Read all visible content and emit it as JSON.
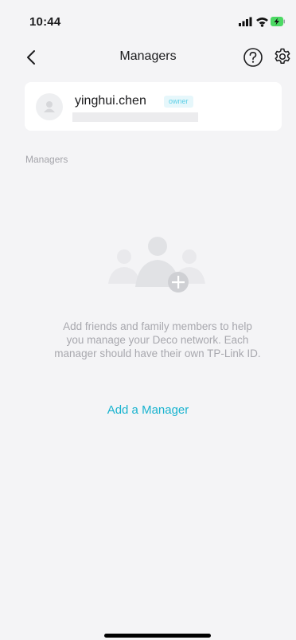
{
  "status_bar": {
    "time": "10:44"
  },
  "nav": {
    "title": "Managers"
  },
  "owner": {
    "name": "yinghui.chen",
    "badge": "owner"
  },
  "section": {
    "label": "Managers"
  },
  "empty_state": {
    "message_lines": [
      "Add friends and family members to help",
      "you manage your Deco network. Each",
      "manager should have their own TP-Link ID."
    ],
    "add_label": "Add a Manager"
  },
  "colors": {
    "accent": "#19b3cf",
    "background": "#f4f4f6",
    "badge_bg": "#e6f7fb",
    "badge_text": "#5dcfe6",
    "muted_text": "#a8a8ae"
  },
  "icons": [
    "signal-icon",
    "wifi-icon",
    "battery-icon",
    "back-icon",
    "help-icon",
    "settings-icon",
    "avatar",
    "people-illustration",
    "plus-icon"
  ]
}
